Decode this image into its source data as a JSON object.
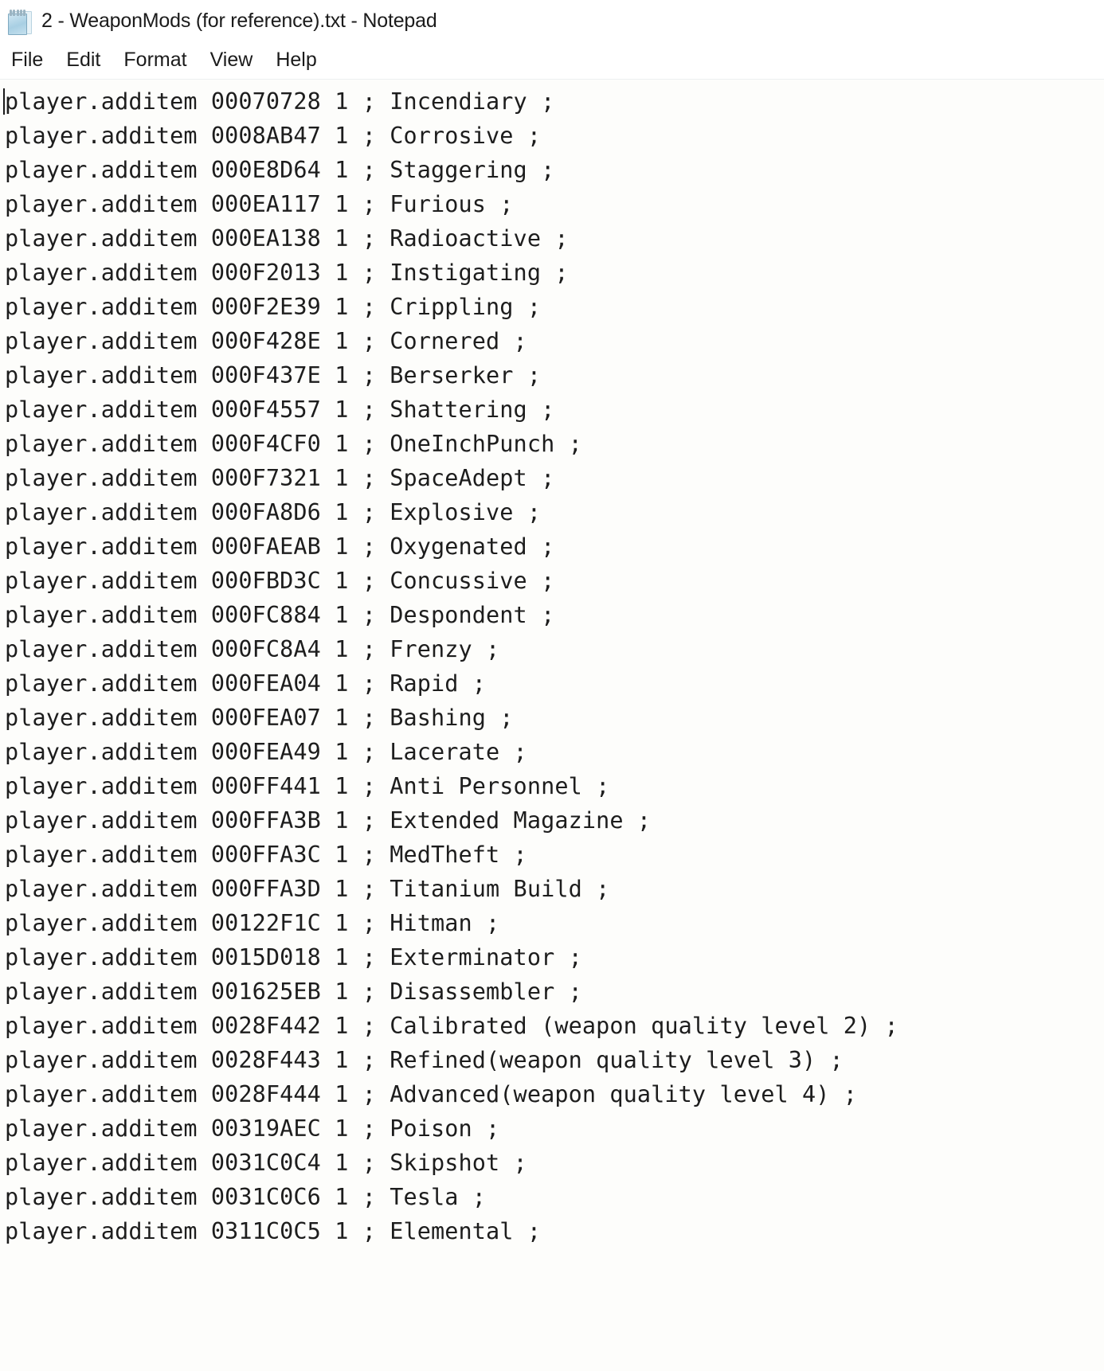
{
  "window": {
    "title": "2 - WeaponMods (for reference).txt - Notepad",
    "icon": "notepad-icon",
    "background_color": "#fdfdfb",
    "text_color": "#1d1d1d"
  },
  "menu": {
    "items": [
      {
        "label": "File"
      },
      {
        "label": "Edit"
      },
      {
        "label": "Format"
      },
      {
        "label": "View"
      },
      {
        "label": "Help"
      }
    ]
  },
  "editor": {
    "caret_line": 1,
    "caret_column": 1,
    "lines": [
      "player.additem 00070728 1 ; Incendiary ;",
      "player.additem 0008AB47 1 ; Corrosive ;",
      "player.additem 000E8D64 1 ; Staggering ;",
      "player.additem 000EA117 1 ; Furious ;",
      "player.additem 000EA138 1 ; Radioactive ;",
      "player.additem 000F2013 1 ; Instigating ;",
      "player.additem 000F2E39 1 ; Crippling ;",
      "player.additem 000F428E 1 ; Cornered ;",
      "player.additem 000F437E 1 ; Berserker ;",
      "player.additem 000F4557 1 ; Shattering ;",
      "player.additem 000F4CF0 1 ; OneInchPunch ;",
      "player.additem 000F7321 1 ; SpaceAdept ;",
      "player.additem 000FA8D6 1 ; Explosive ;",
      "player.additem 000FAEAB 1 ; Oxygenated ;",
      "player.additem 000FBD3C 1 ; Concussive ;",
      "player.additem 000FC884 1 ; Despondent ;",
      "player.additem 000FC8A4 1 ; Frenzy ;",
      "player.additem 000FEA04 1 ; Rapid ;",
      "player.additem 000FEA07 1 ; Bashing ;",
      "player.additem 000FEA49 1 ; Lacerate ;",
      "player.additem 000FF441 1 ; Anti Personnel ;",
      "player.additem 000FFA3B 1 ; Extended Magazine ;",
      "player.additem 000FFA3C 1 ; MedTheft ;",
      "player.additem 000FFA3D 1 ; Titanium Build ;",
      "player.additem 00122F1C 1 ; Hitman ;",
      "player.additem 0015D018 1 ; Exterminator ;",
      "player.additem 001625EB 1 ; Disassembler ;",
      "player.additem 0028F442 1 ; Calibrated (weapon quality level 2) ;",
      "player.additem 0028F443 1 ; Refined(weapon quality level 3) ;",
      "player.additem 0028F444 1 ; Advanced(weapon quality level 4) ;",
      "player.additem 00319AEC 1 ; Poison ;",
      "player.additem 0031C0C4 1 ; Skipshot ;",
      "player.additem 0031C0C6 1 ; Tesla ;",
      "player.additem 0311C0C5 1 ; Elemental ;"
    ]
  }
}
